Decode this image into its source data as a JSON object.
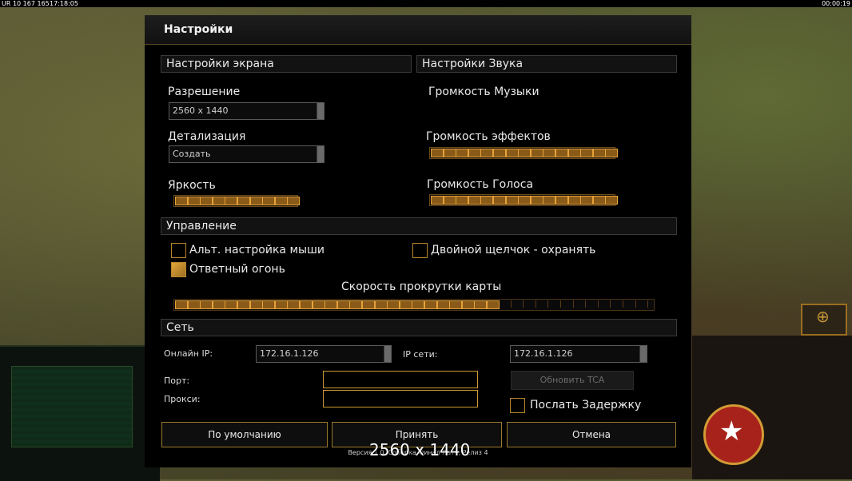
{
  "hud": {
    "left_text": "UR 10 167 165",
    "clock_left": "17:18:05",
    "clock_right": "00:00:19"
  },
  "dialog": {
    "title": "Настройки",
    "version": "Версия 1.0, Соборка Финал Патч, Релиз 4"
  },
  "screen": {
    "header": "Настройки экрана",
    "resolution_label": "Разрешение",
    "resolution_value": "2560 x 1440",
    "detail_label": "Детализация",
    "detail_value": "Создать",
    "brightness_label": "Яркость",
    "brightness_level": 10
  },
  "sound": {
    "header": "Настройки Звука",
    "music_label": "Громкость Музыки",
    "effects_label": "Громкость эффектов",
    "effects_level": 15,
    "voice_label": "Громкость Голоса",
    "voice_level": 15
  },
  "controls": {
    "header": "Управление",
    "alt_mouse": "Альт. настройка мыши",
    "alt_mouse_checked": false,
    "double_click": "Двойной щелчок - охранять",
    "double_click_checked": false,
    "return_fire": "Ответный огонь",
    "return_fire_checked": true,
    "scroll_label": "Скорость прокрутки карты",
    "scroll_level": 26,
    "scroll_total": 38
  },
  "network": {
    "header": "Сеть",
    "online_ip_label": "Онлайн IP:",
    "online_ip_value": "172.16.1.126",
    "lan_ip_label": "IP сети:",
    "lan_ip_value": "172.16.1.126",
    "port_label": "Порт:",
    "proxy_label": "Прокси:",
    "update_tca": "Обновить TCA",
    "send_delay": "Послать Задержку",
    "send_delay_checked": false
  },
  "buttons": {
    "defaults": "По умолчанию",
    "accept": "Принять",
    "cancel": "Отмена"
  },
  "overlay_text": "2560 x 1440",
  "colors": {
    "accent": "#e2a63b",
    "panel_bg": "#000000",
    "border": "#9c7a2e"
  }
}
